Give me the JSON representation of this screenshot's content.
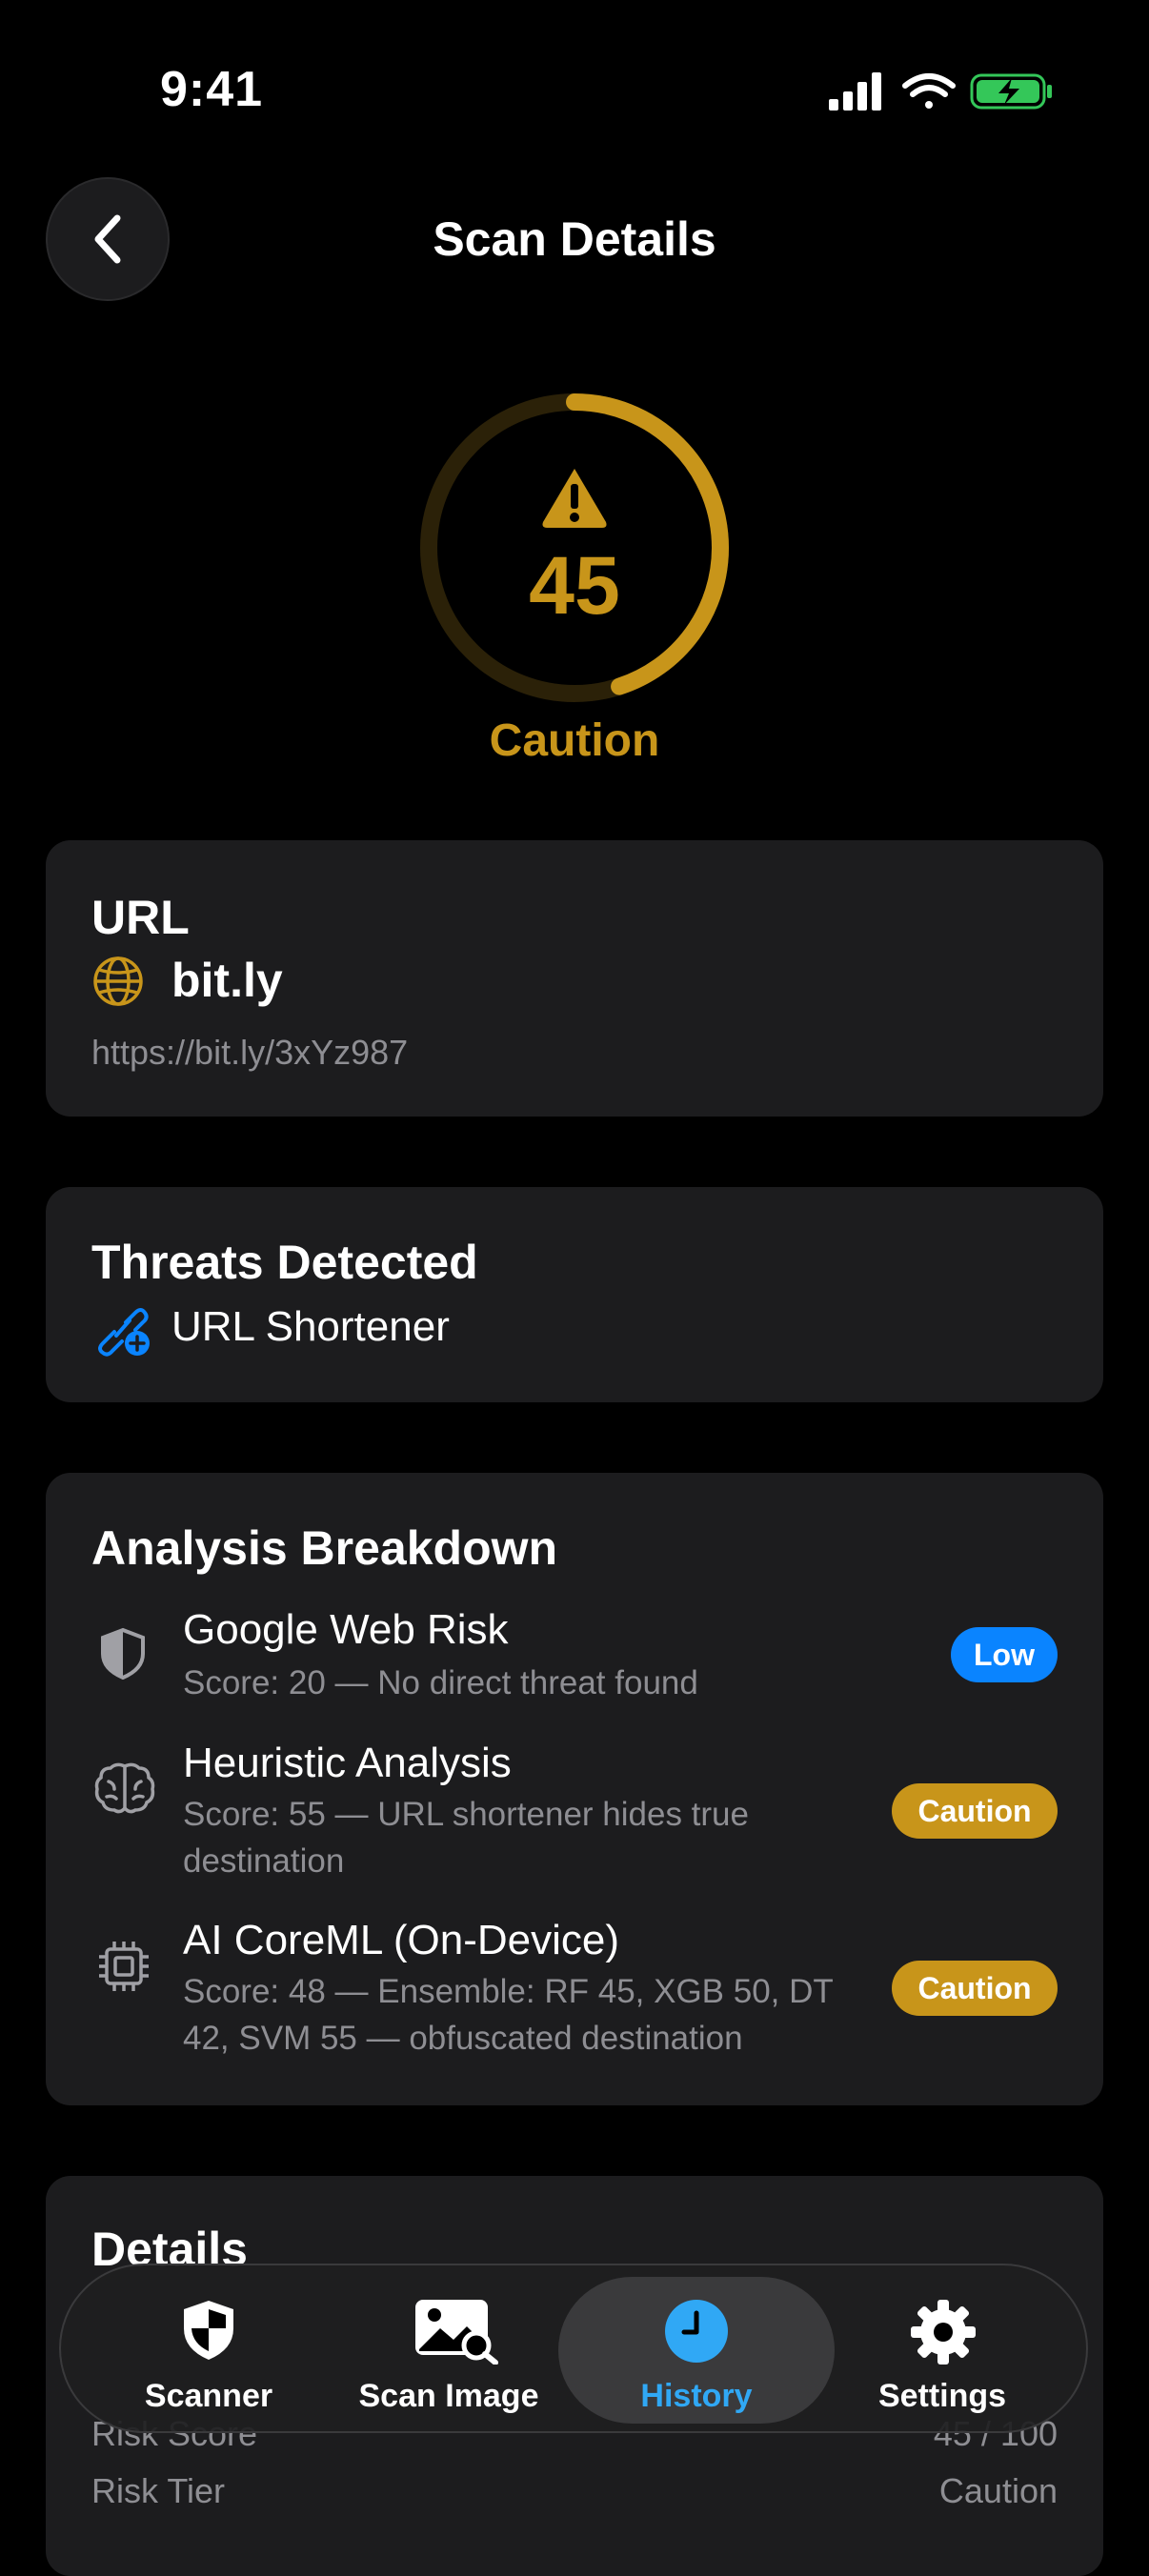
{
  "status_bar": {
    "time": "9:41"
  },
  "header": {
    "title": "Scan Details"
  },
  "score": {
    "value": "45",
    "label": "Caution",
    "progress_fraction": 0.45,
    "color": "#c8951a"
  },
  "url_card": {
    "title": "URL",
    "host": "bit.ly",
    "full_url": "https://bit.ly/3xYz987"
  },
  "threats_card": {
    "title": "Threats Detected",
    "items": [
      {
        "label": "URL Shortener"
      }
    ]
  },
  "analysis_card": {
    "title": "Analysis Breakdown",
    "rows": [
      {
        "icon": "shield-half-icon",
        "title": "Google Web Risk",
        "subtitle_lines": [
          "Score: 20 — No direct threat found"
        ],
        "badge": "Low",
        "badge_color": "#0a84ff"
      },
      {
        "icon": "brain-icon",
        "title": "Heuristic Analysis",
        "subtitle_lines": [
          "Score: 55 — URL shortener hides true",
          "destination"
        ],
        "badge": "Caution",
        "badge_color": "#c8951a"
      },
      {
        "icon": "chip-icon",
        "title": "AI CoreML (On-Device)",
        "subtitle_lines": [
          "Score: 48 — Ensemble: RF 45, XGB 50, DT",
          "42, SVM 55 — obfuscated destination"
        ],
        "badge": "Caution",
        "badge_color": "#c8951a"
      }
    ]
  },
  "details_card": {
    "title": "Details",
    "rows": [
      {
        "label": "Risk Score",
        "value": "45 / 100"
      },
      {
        "label": "Risk Tier",
        "value": "Caution"
      }
    ]
  },
  "tab_bar": {
    "tabs": [
      {
        "label": "Scanner",
        "icon": "shield-icon",
        "active": false
      },
      {
        "label": "Scan Image",
        "icon": "image-search-icon",
        "active": false
      },
      {
        "label": "History",
        "icon": "clock-icon",
        "active": true
      },
      {
        "label": "Settings",
        "icon": "gear-icon",
        "active": false
      }
    ],
    "active_color": "#30a8f5"
  }
}
